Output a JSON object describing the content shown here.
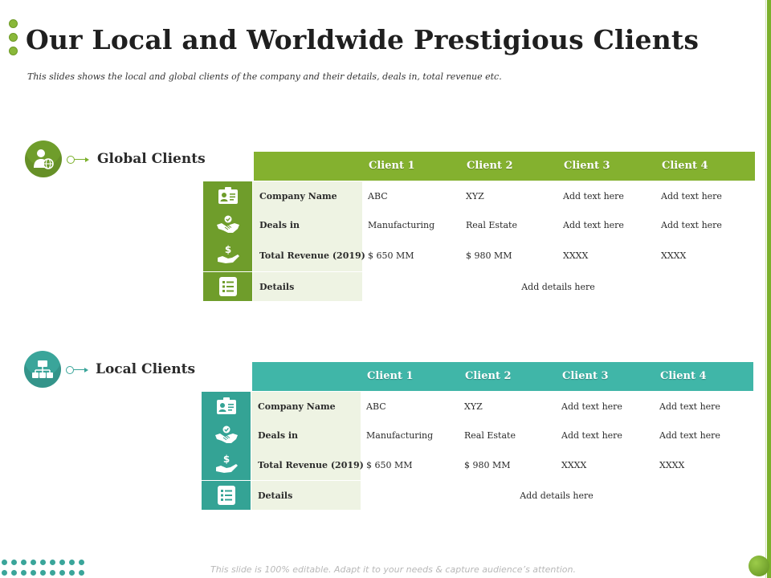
{
  "title": "Our Local and Worldwide Prestigious Clients",
  "subtitle": "This slides shows the local and global clients of the company and their details, deals in, total revenue etc.",
  "footer": "This slide is 100% editable. Adapt it to your needs & capture audience’s attention.",
  "colors": {
    "accent_green": "#84b12f",
    "accent_teal": "#40b6a8"
  },
  "global": {
    "label": "Global Clients",
    "icon": "person-globe-icon",
    "headers": [
      "Client 1",
      "Client 2",
      "Client 3",
      "Client 4"
    ],
    "rows": [
      {
        "icon": "id-card-icon",
        "label": "Company Name",
        "values": [
          "ABC",
          "XYZ",
          "Add text here",
          "Add text here"
        ]
      },
      {
        "icon": "handshake-icon",
        "label": "Deals in",
        "values": [
          "Manufacturing",
          "Real Estate",
          "Add text here",
          "Add text here"
        ]
      },
      {
        "icon": "money-hand-icon",
        "label": "Total Revenue (2019)",
        "values": [
          "$ 650 MM",
          "$ 980 MM",
          "XXXX",
          "XXXX"
        ]
      }
    ],
    "details": {
      "icon": "list-icon",
      "label": "Details",
      "value": "Add details here"
    }
  },
  "local": {
    "label": "Local Clients",
    "icon": "org-chart-icon",
    "headers": [
      "Client 1",
      "Client 2",
      "Client 3",
      "Client 4"
    ],
    "rows": [
      {
        "icon": "id-card-icon",
        "label": "Company Name",
        "values": [
          "ABC",
          "XYZ",
          "Add text here",
          "Add text here"
        ]
      },
      {
        "icon": "handshake-icon",
        "label": "Deals in",
        "values": [
          "Manufacturing",
          "Real Estate",
          "Add text here",
          "Add text here"
        ]
      },
      {
        "icon": "money-hand-icon",
        "label": "Total Revenue (2019)",
        "values": [
          "$ 650 MM",
          "$ 980 MM",
          "XXXX",
          "XXXX"
        ]
      }
    ],
    "details": {
      "icon": "list-icon",
      "label": "Details",
      "value": "Add details here"
    }
  }
}
